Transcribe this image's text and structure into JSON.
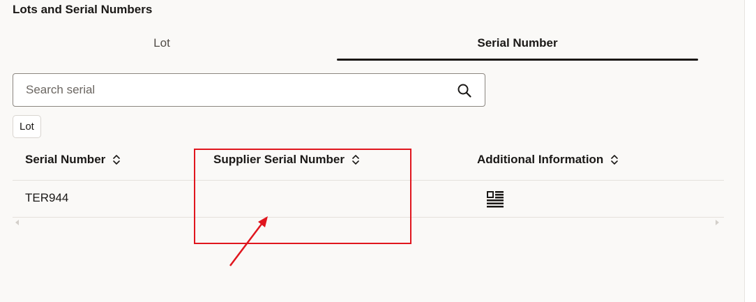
{
  "section_title": "Lots and Serial Numbers",
  "tabs": [
    {
      "label": "Lot",
      "selected": false
    },
    {
      "label": "Serial Number",
      "selected": true
    }
  ],
  "search": {
    "placeholder": "Search serial",
    "value": ""
  },
  "filter_chip": "Lot",
  "table": {
    "columns": [
      "Serial Number",
      "Supplier Serial Number",
      "Additional Information"
    ],
    "rows": [
      {
        "serial_number": "TER944",
        "supplier_serial_number": "",
        "additional_information_icon": "detail-list-icon"
      }
    ]
  },
  "annotation": {
    "color": "#e0161e"
  },
  "icons": {
    "search": "search-icon",
    "sort": "sort-icon",
    "detail": "detail-list-icon"
  }
}
